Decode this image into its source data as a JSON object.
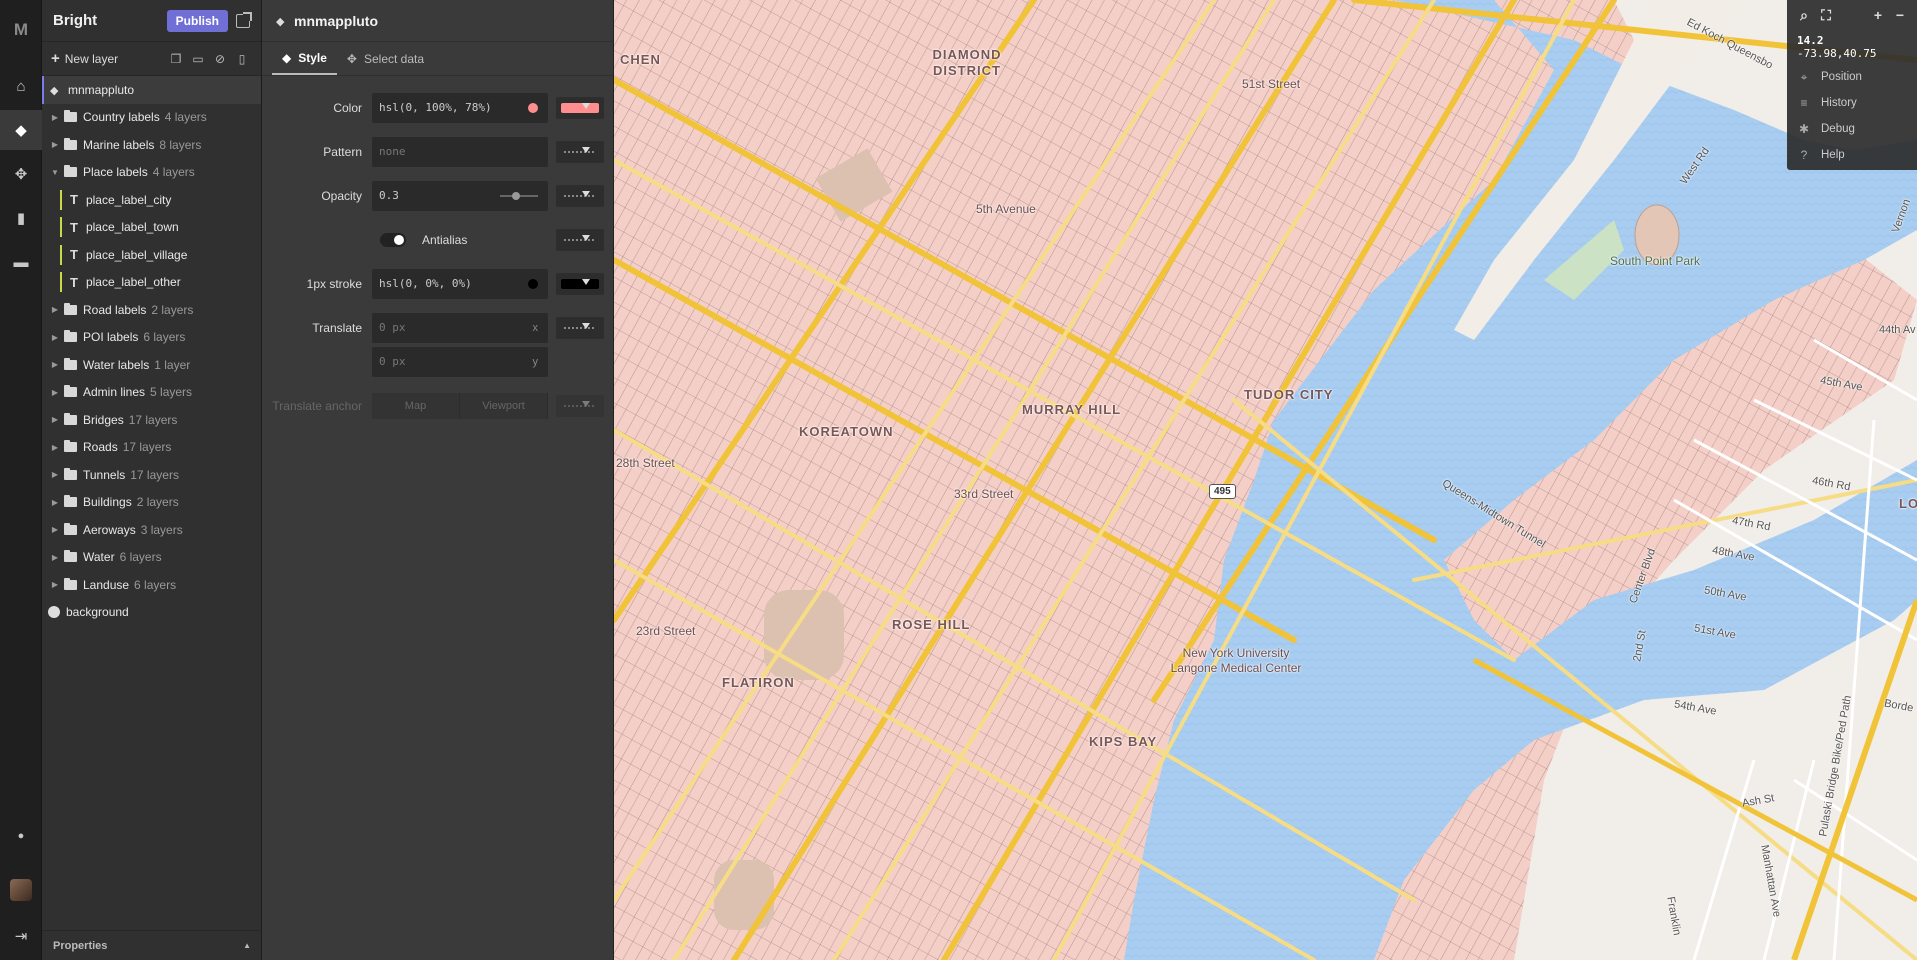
{
  "rail": {
    "logo": "M",
    "items": [
      {
        "name": "home",
        "glyph": "⌂"
      },
      {
        "name": "style",
        "glyph": "◆"
      },
      {
        "name": "sources",
        "glyph": "✥"
      },
      {
        "name": "stats",
        "glyph": "▮"
      },
      {
        "name": "files",
        "glyph": "▬"
      }
    ],
    "bottom": [
      {
        "name": "notifications",
        "glyph": "●"
      },
      {
        "name": "logout",
        "glyph": "⇥"
      }
    ]
  },
  "layers_panel": {
    "title": "Bright",
    "publish_label": "Publish",
    "new_layer_label": "New layer",
    "properties_label": "Properties",
    "properties_glyph": "▲",
    "tree": [
      {
        "type": "layer",
        "label": "mnmappluto",
        "icon": "fill",
        "selected": true
      },
      {
        "type": "folder",
        "label": "Country labels",
        "count": "4 layers",
        "expanded": false
      },
      {
        "type": "folder",
        "label": "Marine labels",
        "count": "8 layers",
        "expanded": false
      },
      {
        "type": "folder",
        "label": "Place labels",
        "count": "4 layers",
        "expanded": true
      },
      {
        "type": "child",
        "label": "place_label_city"
      },
      {
        "type": "child",
        "label": "place_label_town"
      },
      {
        "type": "child",
        "label": "place_label_village"
      },
      {
        "type": "child",
        "label": "place_label_other"
      },
      {
        "type": "folder",
        "label": "Road labels",
        "count": "2 layers",
        "expanded": false
      },
      {
        "type": "folder",
        "label": "POI labels",
        "count": "6 layers",
        "expanded": false
      },
      {
        "type": "folder",
        "label": "Water labels",
        "count": "1 layer",
        "expanded": false
      },
      {
        "type": "folder",
        "label": "Admin lines",
        "count": "5 layers",
        "expanded": false
      },
      {
        "type": "folder",
        "label": "Bridges",
        "count": "17 layers",
        "expanded": false
      },
      {
        "type": "folder",
        "label": "Roads",
        "count": "17 layers",
        "expanded": false
      },
      {
        "type": "folder",
        "label": "Tunnels",
        "count": "17 layers",
        "expanded": false
      },
      {
        "type": "folder",
        "label": "Buildings",
        "count": "2 layers",
        "expanded": false
      },
      {
        "type": "folder",
        "label": "Aeroways",
        "count": "3 layers",
        "expanded": false
      },
      {
        "type": "folder",
        "label": "Water",
        "count": "6 layers",
        "expanded": false
      },
      {
        "type": "folder",
        "label": "Landuse",
        "count": "6 layers",
        "expanded": false
      },
      {
        "type": "layer",
        "label": "background",
        "icon": "globe",
        "selected": false
      }
    ]
  },
  "style_panel": {
    "layer_name": "mnmappluto",
    "tabs": [
      {
        "label": "Style",
        "active": true
      },
      {
        "label": "Select data",
        "active": false
      }
    ],
    "props": {
      "color": {
        "label": "Color",
        "value": "hsl(0, 100%, 78%)",
        "swatch": "#ff8f8f"
      },
      "pattern": {
        "label": "Pattern",
        "value": "none"
      },
      "opacity": {
        "label": "Opacity",
        "value": "0.3"
      },
      "antialias": {
        "label": "Antialias",
        "on": true
      },
      "stroke": {
        "label": "1px stroke",
        "value": "hsl(0, 0%, 0%)",
        "swatch": "#000000"
      },
      "translate": {
        "label": "Translate",
        "x_value": "0",
        "y_value": "0",
        "unit": "px",
        "x_axis": "x",
        "y_axis": "y"
      },
      "translate_anchor": {
        "label": "Translate anchor",
        "options": [
          "Map",
          "Viewport"
        ]
      }
    }
  },
  "map": {
    "zoom": "14.2",
    "coords": "-73.98,40.75",
    "controls": [
      {
        "label": "Position",
        "glyph": "⌖"
      },
      {
        "label": "History",
        "glyph": "≡"
      },
      {
        "label": "Debug",
        "glyph": "✱"
      },
      {
        "label": "Help",
        "glyph": "?"
      }
    ],
    "labels": {
      "diamond_district": "DIAMOND DISTRICT",
      "murray_hill": "MURRAY HILL",
      "koreatown": "KOREATOWN",
      "tudor_city": "TUDOR CITY",
      "rose_hill": "ROSE HILL",
      "flatiron": "FLATIRON",
      "kips_bay": "KIPS BAY",
      "chen": "CHEN",
      "lo": "LO",
      "fifth_avenue": "5th Avenue",
      "fiftyfirst_street": "51st Street",
      "thirtythird_street": "33rd Street",
      "twentyeighth_street": "28th Street",
      "twentythird_street": "23rd Street",
      "south_point_park": "South Point Park",
      "nyu_langone": "New York University Langone Medical Center",
      "queens_midtown_tunnel": "Queens-Midtown Tunnel",
      "ed_koch": "Ed Koch Queensbo",
      "west_rd": "West Rd",
      "center_blvd": "Center Blvd",
      "forty_fourth": "44th Av",
      "forty_fifth": "45th Ave",
      "forty_sixth": "46th Rd",
      "forty_seventh": "47th Rd",
      "forty_eighth": "48th Ave",
      "fiftieth": "50th Ave",
      "fifty_first": "51st Ave",
      "fifty_fourth": "54th Ave",
      "ash_st": "Ash St",
      "manhattan_ave": "Manhattan Ave",
      "franklin": "Franklin",
      "pulaski": "Pulaski Bridge Bike/Ped Path",
      "borde": "Borde",
      "vernon": "Vernon",
      "second_st": "2nd St",
      "shield_495": "495"
    }
  }
}
